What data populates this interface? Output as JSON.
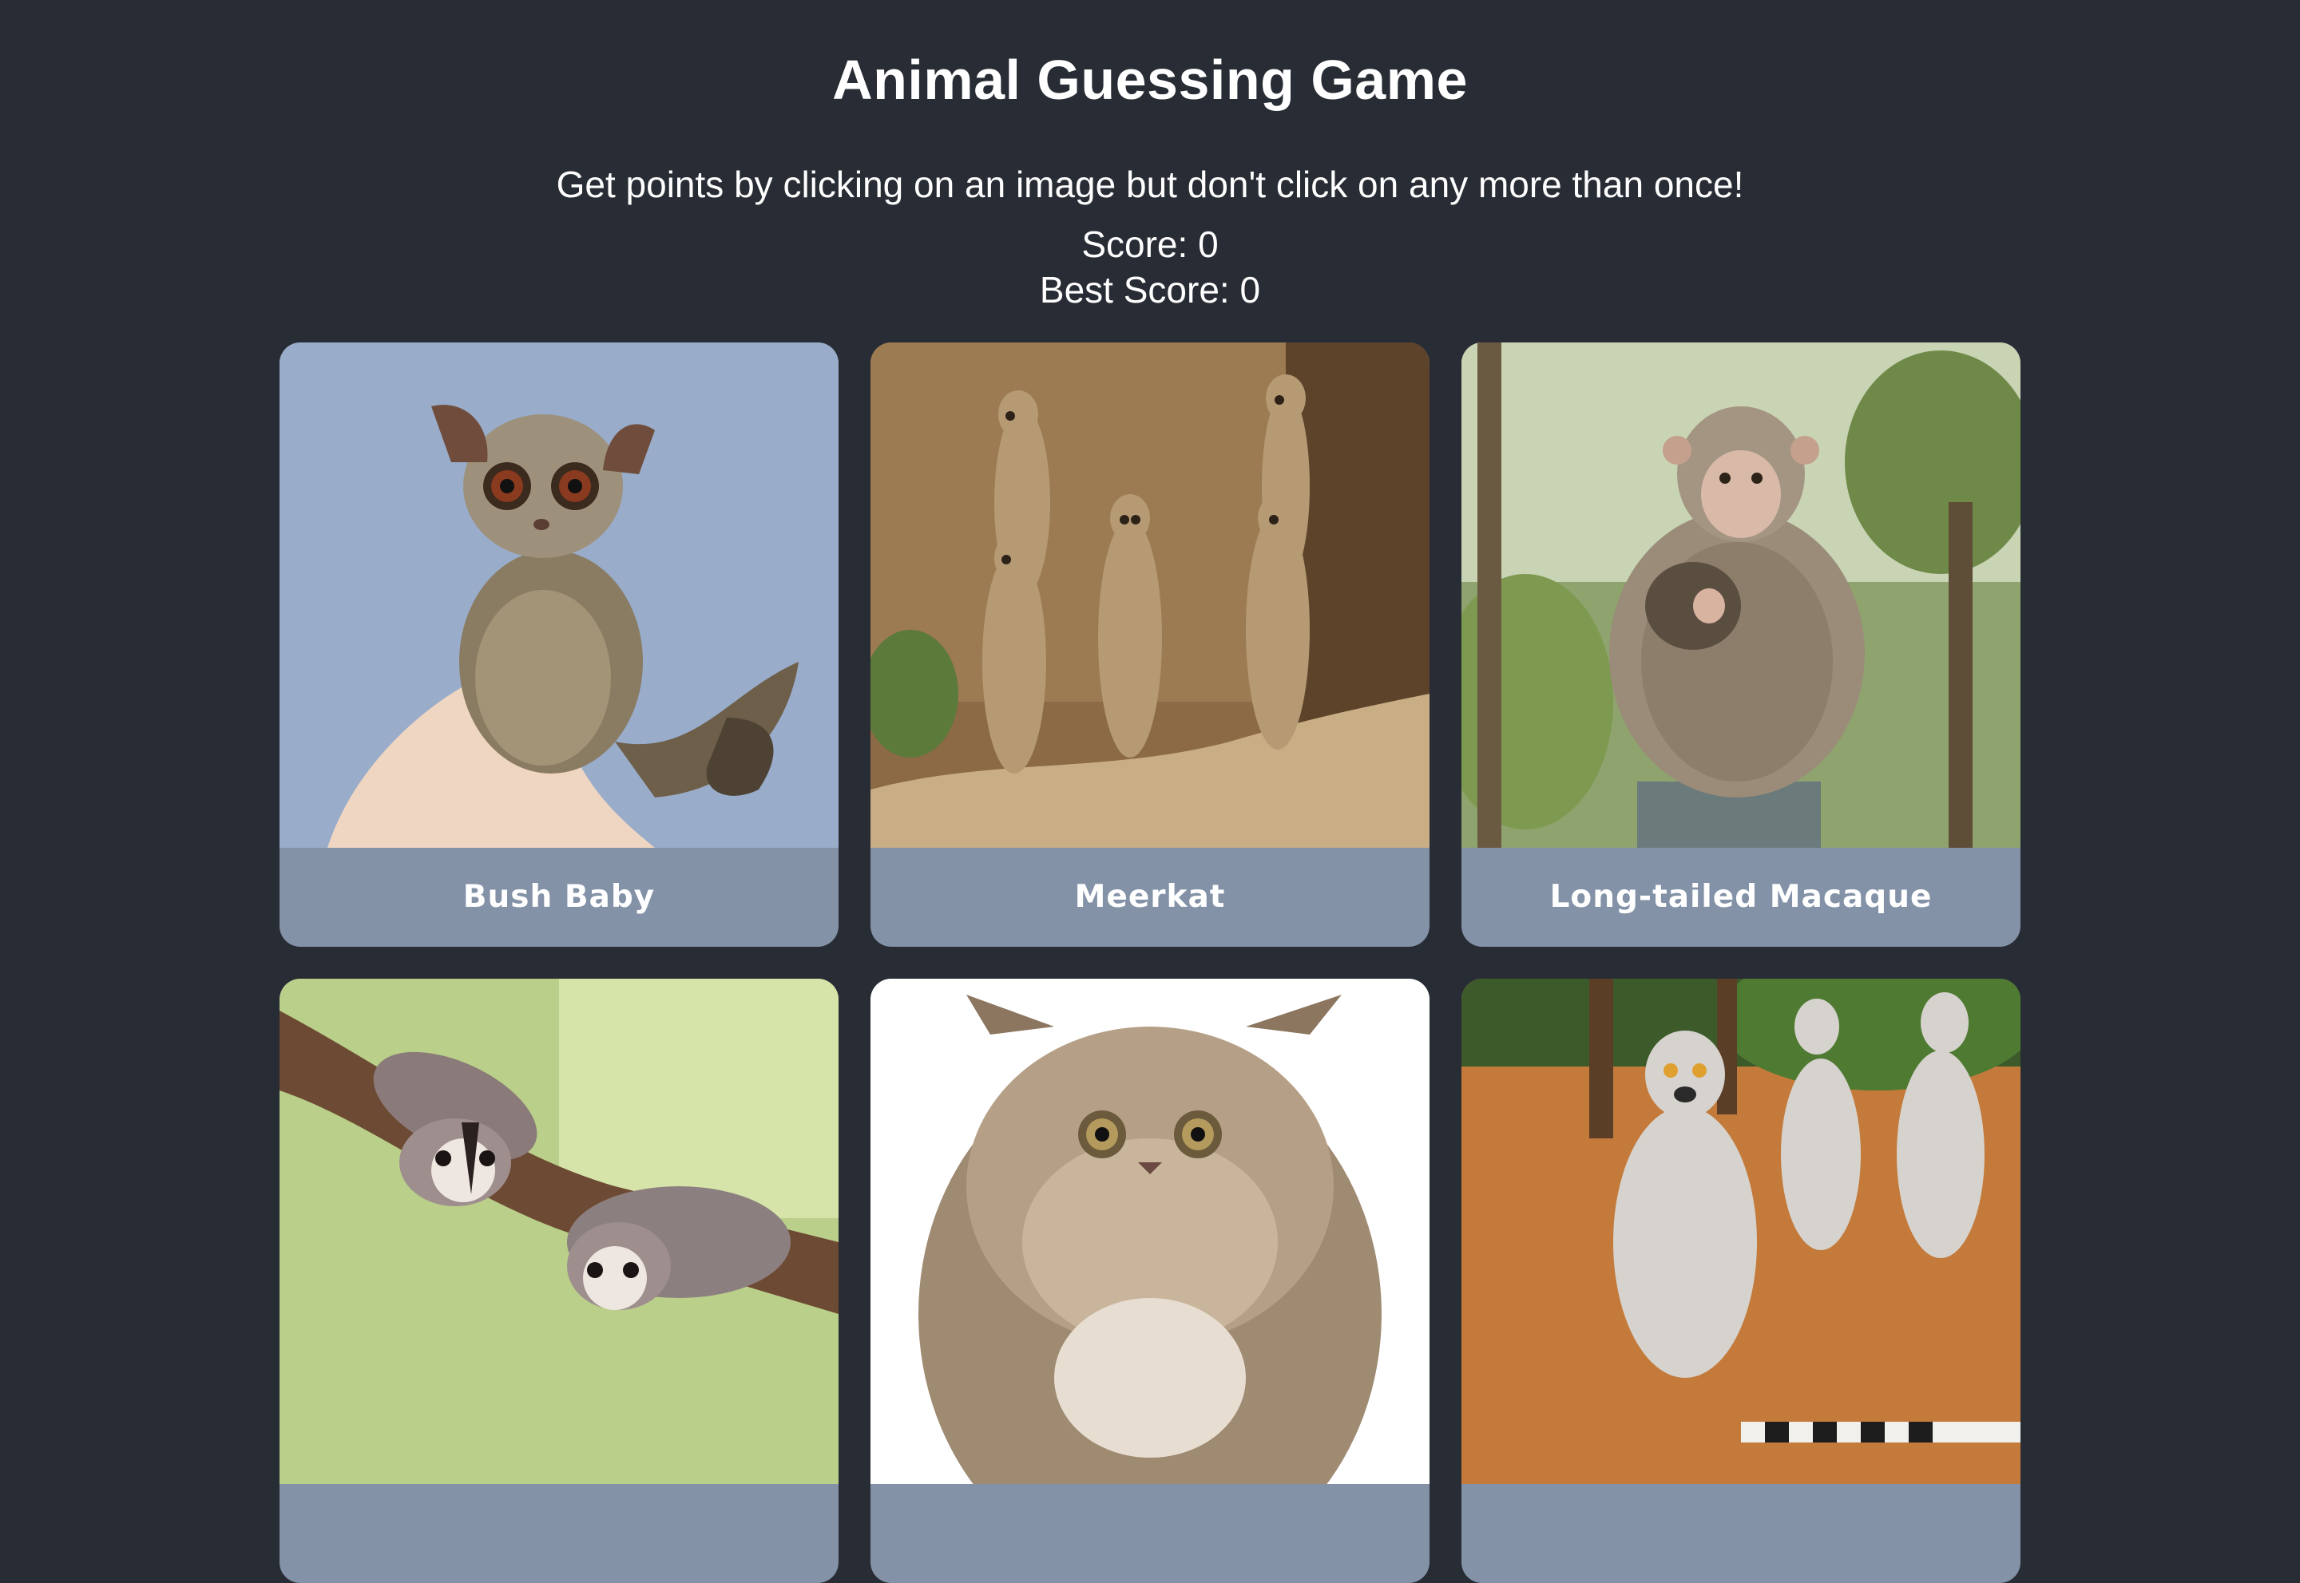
{
  "header": {
    "title": "Animal Guessing Game",
    "instructions": "Get points by clicking on an image but don't click on any more than once!"
  },
  "scoreboard": {
    "score_text": "Score: 0",
    "best_score_text": "Best Score: 0",
    "score": 0,
    "best_score": 0
  },
  "cards": [
    {
      "label": "Bush Baby",
      "icon": "bush-baby-photo"
    },
    {
      "label": "Meerkat",
      "icon": "meerkat-photo"
    },
    {
      "label": "Long-tailed Macaque",
      "icon": "macaque-photo"
    },
    {
      "label": "",
      "icon": "sugar-glider-photo"
    },
    {
      "label": "",
      "icon": "persian-cat-photo"
    },
    {
      "label": "",
      "icon": "ring-tailed-lemur-photo"
    }
  ],
  "colors": {
    "background": "#282c34",
    "card_label_bg": "#8392a7",
    "text": "#ffffff"
  }
}
